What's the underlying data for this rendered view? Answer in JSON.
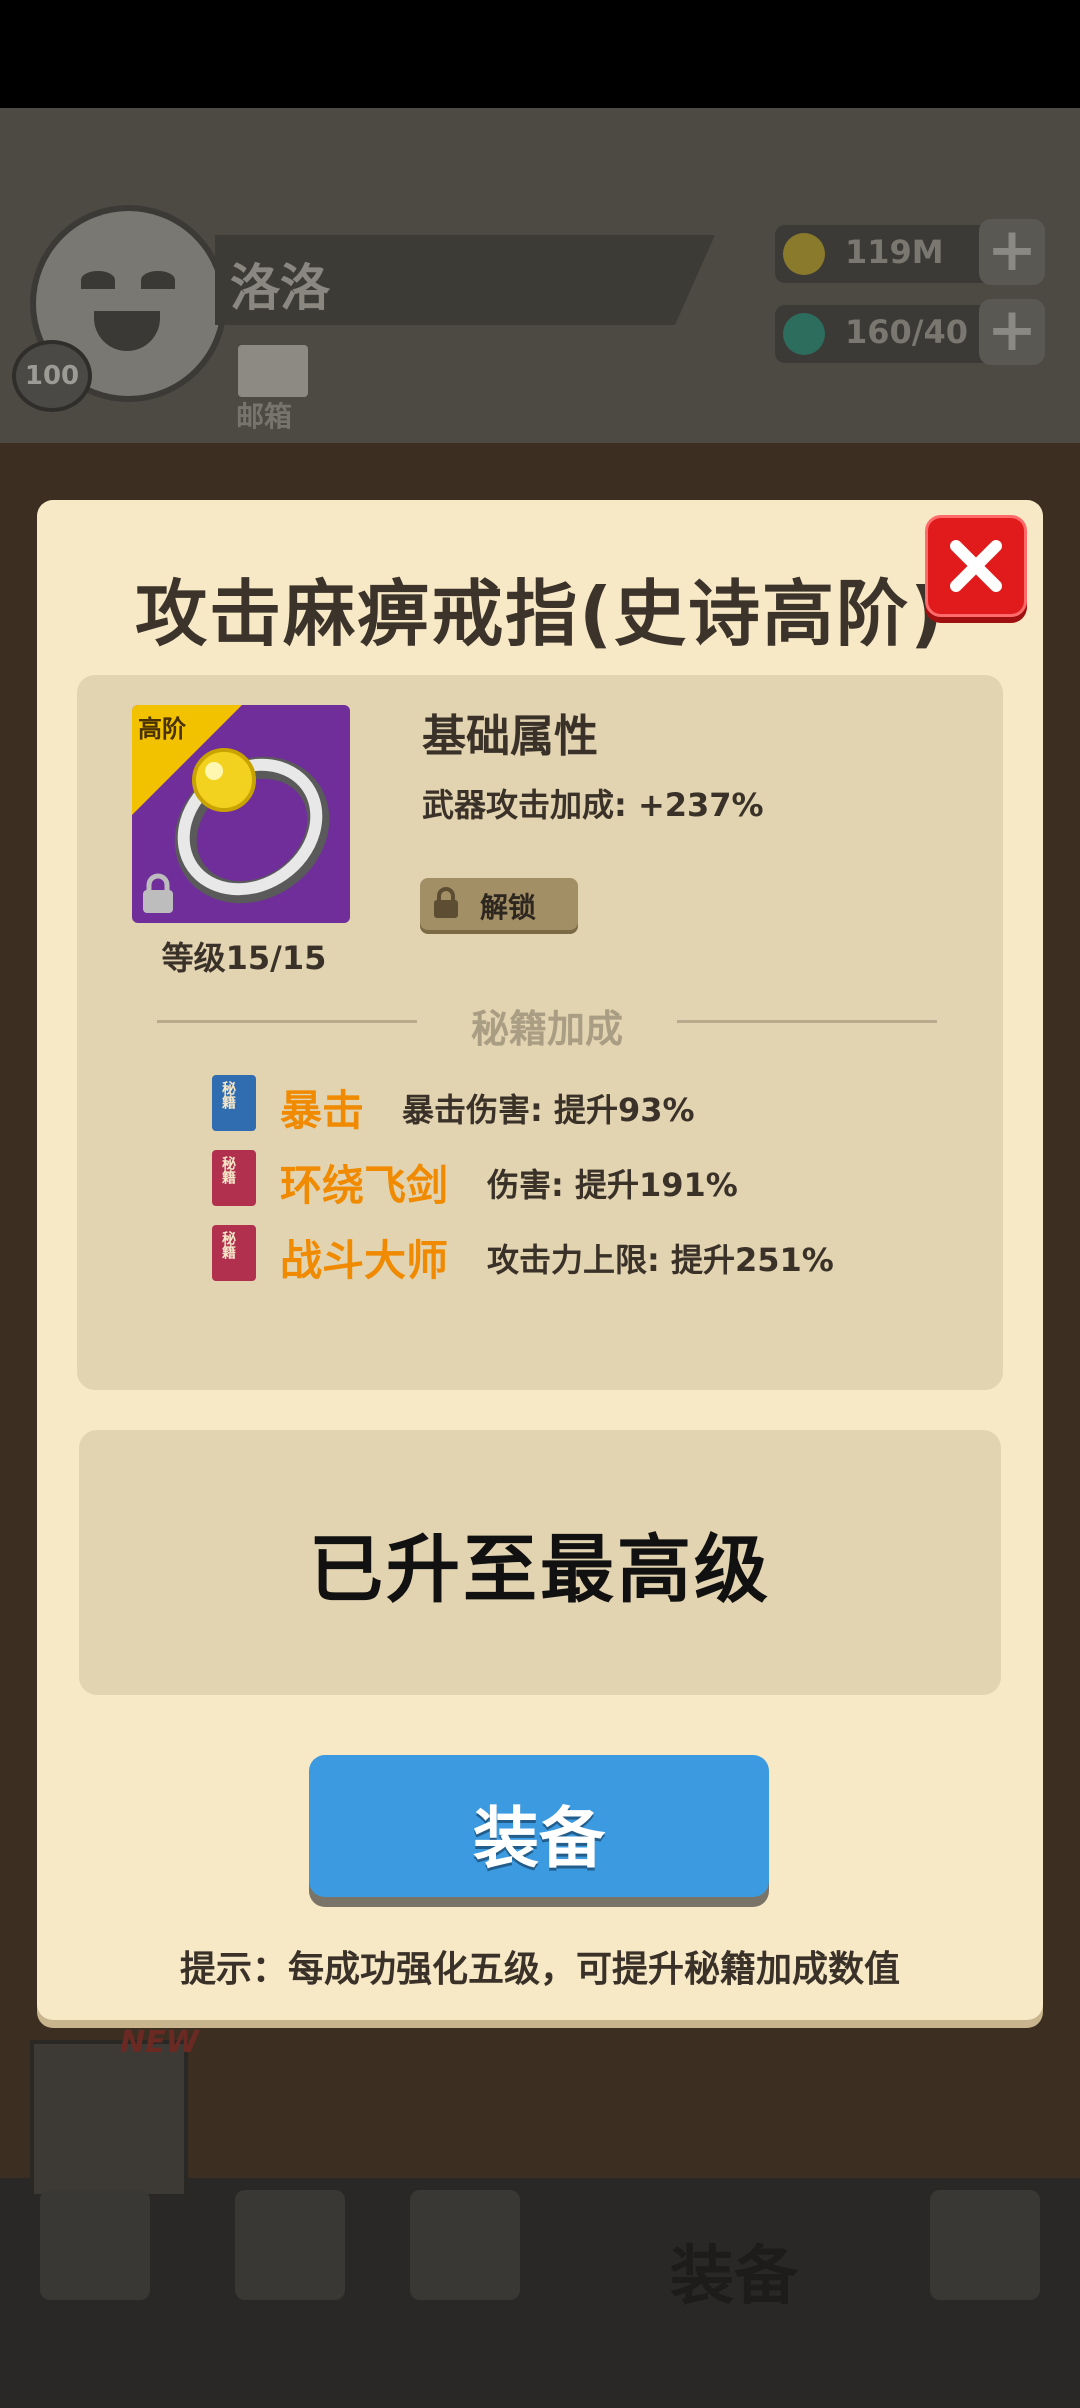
{
  "background": {
    "player_name": "洛洛",
    "player_level": "100",
    "mail_label": "邮箱",
    "gold": "119M",
    "gems": "160/40",
    "new_badge": "NEW",
    "nav_current_label": "装备"
  },
  "modal": {
    "title": "攻击麻痹戒指(史诗高阶)",
    "item": {
      "rank_label": "高阶",
      "level_text": "等级15/15"
    },
    "base_attrs": {
      "title": "基础属性",
      "line": "武器攻击加成: +237%"
    },
    "unlock_label": "解锁",
    "bonus_section_title": "秘籍加成",
    "book_glyph": "秘籍",
    "bonuses": [
      {
        "name": "暴击",
        "effect": "暴击伤害: 提升93%",
        "book_color": "#2f6db0"
      },
      {
        "name": "环绕飞剑",
        "effect": "伤害: 提升191%",
        "book_color": "#b0304e"
      },
      {
        "name": "战斗大师",
        "effect": "攻击力上限: 提升251%",
        "book_color": "#b0304e"
      }
    ],
    "max_level_text": "已升至最高级",
    "equip_label": "装备",
    "tip": "提示：每成功强化五级，可提升秘籍加成数值"
  },
  "colors": {
    "modal_bg": "#f7e8c6",
    "panel_bg": "#e2d3b1",
    "skill_orange": "#f08a00",
    "equip_blue": "#3b9ae0",
    "close_red": "#e11b1b"
  }
}
